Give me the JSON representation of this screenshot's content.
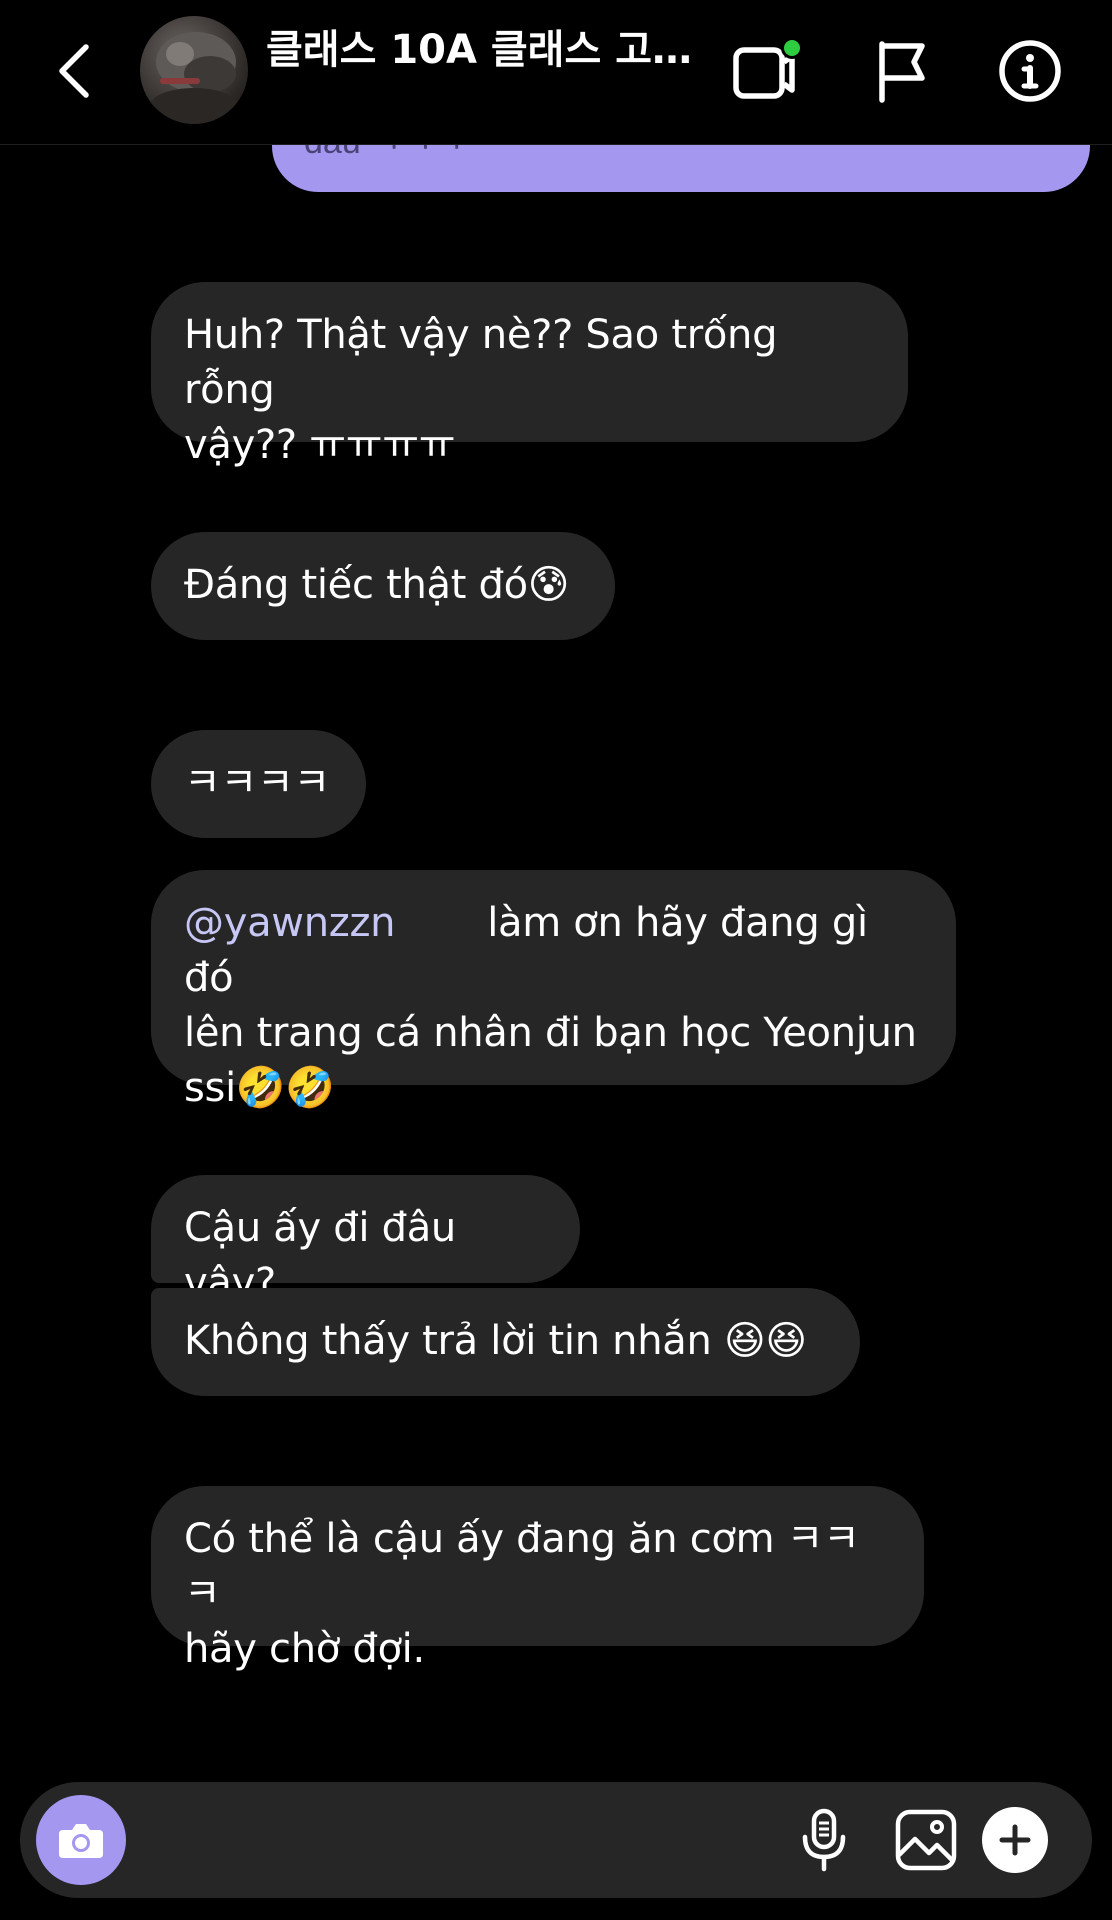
{
  "header": {
    "title": "클래스 10A 클래스 고…",
    "back_icon": "chevron-left-icon",
    "video_call_icon": "video-call-icon",
    "flag_icon": "flag-icon",
    "info_icon": "info-icon",
    "active_status_color": "#2ecc40"
  },
  "messages": {
    "outgoing_partial": "đâu ㅋㅋㅋ",
    "m1_line1": "Huh? Thật vậy nè?? Sao trống rỗng",
    "m1_line2": "vậy?? ㅠㅠㅠㅠ",
    "m2": "Đáng tiếc thật đó😰",
    "m3": "ㅋㅋㅋㅋ",
    "m4_mention": "@yawnzzn",
    "m4_line1_rest": "làm ơn hãy đang gì đó",
    "m4_line2": "lên trang cá nhân đi bạn học Yeonjun",
    "m4_line3": "ssi🤣🤣",
    "m5": "Cậu ấy đi đâu vậy?",
    "m6": "Không thấy trả lời tin nhắn 😆😆",
    "m7_line1": "Có thể là cậu ấy đang ăn cơm ㅋㅋㅋ",
    "m7_line2": "hãy chờ đợi."
  },
  "composer": {
    "placeholder": "",
    "camera_icon": "camera-icon",
    "mic_icon": "microphone-icon",
    "gallery_icon": "gallery-icon",
    "plus_icon": "plus-icon"
  },
  "colors": {
    "background": "#000000",
    "incoming_bubble": "#262626",
    "outgoing_bubble": "#a497ef",
    "accent": "#a497ef"
  }
}
